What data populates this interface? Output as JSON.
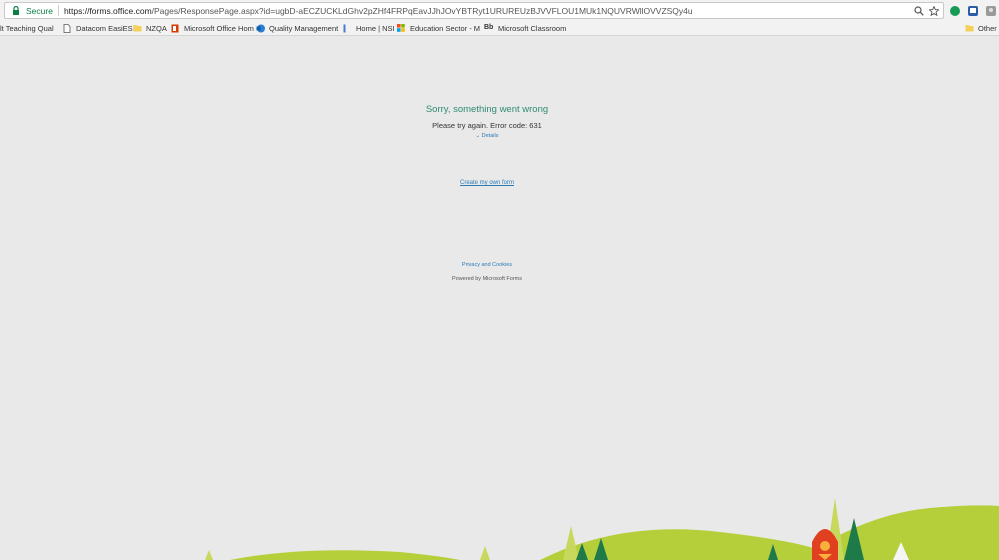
{
  "browser": {
    "secure_label": "Secure",
    "url_host": "https://forms.office.com",
    "url_path": "/Pages/ResponsePage.aspx?id=ugbD-aECZUCKLdGhv2pZHf4FRPqEavJJhJOvYBTRyt1URUREUzBJVVFLOU1MUk1NQUVRWllOVVZSQy4u"
  },
  "bookmarks": [
    {
      "label": "lt Teaching Qual",
      "icon": "none"
    },
    {
      "label": "Datacom EasiESS",
      "icon": "page-icon"
    },
    {
      "label": "NZQA",
      "icon": "folder-icon"
    },
    {
      "label": "Microsoft Office Hom",
      "icon": "office-icon"
    },
    {
      "label": "Quality Management",
      "icon": "sharepoint-icon"
    },
    {
      "label": "Home | NSI",
      "icon": "nsi-icon"
    },
    {
      "label": "Education Sector - M",
      "icon": "windows-icon"
    },
    {
      "label": "Microsoft Classroom",
      "icon": "bb-icon"
    },
    {
      "label": "Other b",
      "icon": "folder-icon"
    }
  ],
  "error": {
    "title": "Sorry, something went wrong",
    "message": "Please try again. Error code: 631",
    "details_label": "⌄ Details"
  },
  "links": {
    "create_form": "Create my own form",
    "privacy": "Privacy and Cookies",
    "powered_by": "Powered by Microsoft Forms"
  },
  "colors": {
    "accent_green": "#2e8b73",
    "link_blue": "#2e7bb6",
    "hill_green": "#b5cf3a",
    "tree_green": "#1f7a4a"
  }
}
